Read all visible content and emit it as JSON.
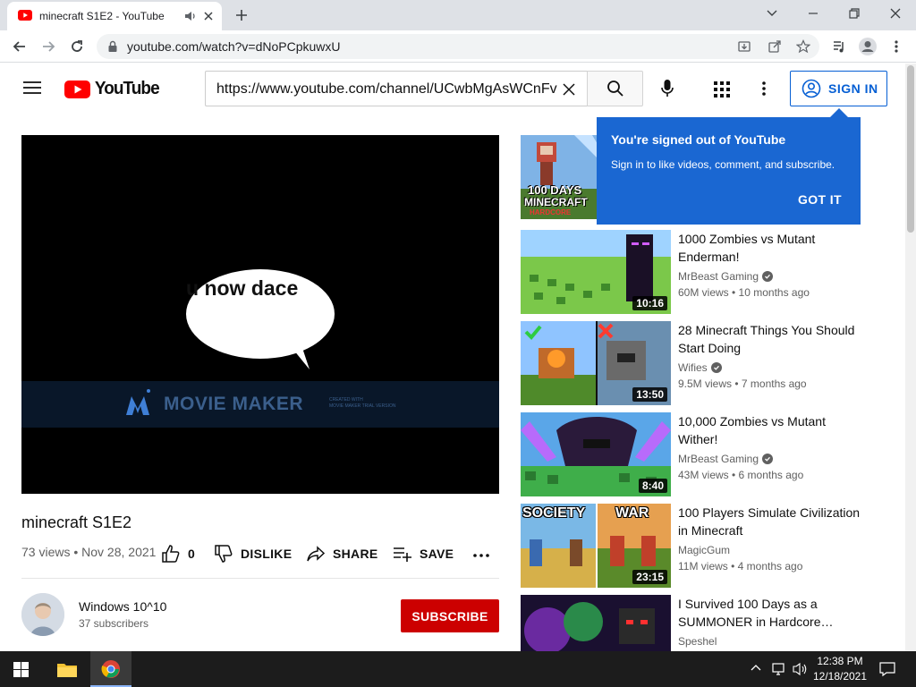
{
  "browser": {
    "tab_title": "minecraft S1E2 - YouTube",
    "url": "youtube.com/watch?v=dNoPCpkuwxU"
  },
  "header": {
    "logo_text": "YouTube",
    "search_value": "https://www.youtube.com/channel/UCwbMgAsWCnFv",
    "signin_label": "SIGN IN"
  },
  "popup": {
    "heading": "You're signed out of YouTube",
    "body": "Sign in to like videos, comment, and subscribe.",
    "button": "GOT IT"
  },
  "player": {
    "caption": "u now dace",
    "watermark": "MOVIE MAKER",
    "watermark_small_1": "CREATED WITH",
    "watermark_small_2": "MOVIE MAKER TRIAL VERSION"
  },
  "video": {
    "title": "minecraft S1E2",
    "meta": "73 views • Nov 28, 2021",
    "likes": "0",
    "dislike_label": "DISLIKE",
    "share_label": "SHARE",
    "save_label": "SAVE"
  },
  "channel": {
    "name": "Windows 10^10",
    "subscribers": "37 subscribers",
    "subscribe_label": "SUBSCRIBE"
  },
  "recommendations": [
    {
      "title": "1000 Zombies vs Mutant Enderman!",
      "channel": "MrBeast Gaming",
      "verified": true,
      "meta": "60M views • 10 months ago",
      "duration": "10:16"
    },
    {
      "title": "28 Minecraft Things You Should Start Doing",
      "channel": "Wifies",
      "verified": true,
      "meta": "9.5M views • 7 months ago",
      "duration": "13:50"
    },
    {
      "title": "10,000 Zombies vs Mutant Wither!",
      "channel": "MrBeast Gaming",
      "verified": true,
      "meta": "43M views • 6 months ago",
      "duration": "8:40"
    },
    {
      "title": "100 Players Simulate Civilization in Minecraft",
      "channel": "MagicGum",
      "verified": true,
      "meta": "11M views • 4 months ago",
      "duration": "23:15"
    },
    {
      "title": "I Survived 100 Days as a SUMMONER in Hardcore…",
      "channel": "Speshel",
      "verified": false,
      "meta": "",
      "duration": ""
    }
  ],
  "thumb_texts": {
    "first": "100 DAYS",
    "first_sub": "MINECRAFT",
    "first_tag": "HARDCORE",
    "society": "SOCIETY",
    "war": "WAR"
  },
  "taskbar": {
    "time": "12:38 PM",
    "date": "12/18/2021"
  },
  "colors": {
    "youtube_red": "#ff0000",
    "signin_blue": "#065fd4",
    "popup_blue": "#1a67d2",
    "subscribe_red": "#cc0000"
  }
}
